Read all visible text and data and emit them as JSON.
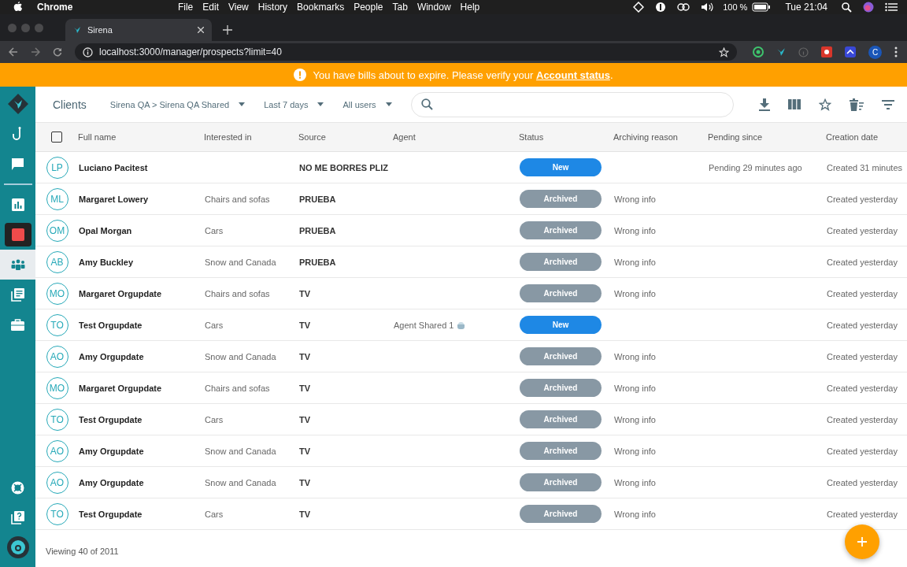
{
  "menu_bar": {
    "app": "Chrome",
    "items": [
      "File",
      "Edit",
      "View",
      "History",
      "Bookmarks",
      "People",
      "Tab",
      "Window",
      "Help"
    ],
    "battery": "100 %",
    "clock": "Tue 21:04"
  },
  "browser": {
    "tab_title": "Sirena",
    "url": "localhost:3000/manager/prospects?limit=40",
    "profile": "C"
  },
  "banner": {
    "text": "You have bills about to expire. Please verify your",
    "link": "Account status",
    "tail": "."
  },
  "sidebar": {
    "items": [
      {
        "kind": "hook",
        "selected": false
      },
      {
        "kind": "chat",
        "selected": false
      },
      {
        "kind": "divider",
        "selected": false
      },
      {
        "kind": "chart",
        "selected": false
      },
      {
        "kind": "record",
        "selected": false
      },
      {
        "kind": "people",
        "selected": true
      },
      {
        "kind": "docs",
        "selected": false
      },
      {
        "kind": "briefcase",
        "selected": false
      }
    ],
    "bottom": [
      {
        "kind": "lifebuoy"
      },
      {
        "kind": "help"
      },
      {
        "kind": "avatar"
      }
    ]
  },
  "header": {
    "title": "Clients",
    "filters": [
      "Sirena QA > Sirena QA Shared",
      "Last 7 days",
      "All users"
    ]
  },
  "table": {
    "select_all": false,
    "columns": [
      "Full name",
      "Interested in",
      "Source",
      "Agent",
      "Status",
      "Archiving reason",
      "Pending since",
      "Creation date"
    ],
    "rows": [
      {
        "initials": "LP",
        "name": "Luciano Pacitest",
        "interest": "",
        "source": "NO ME BORRES PLIZ",
        "agent": "",
        "status": "New",
        "archived": false,
        "reason": "",
        "pending": "Pending 29 minutes ago",
        "created": "Created 31 minutes"
      },
      {
        "initials": "ML",
        "name": "Margaret Lowery",
        "interest": "Chairs and sofas",
        "source": "PRUEBA",
        "agent": "",
        "status": "Archived",
        "archived": true,
        "reason": "Wrong info",
        "pending": "",
        "created": "Created yesterday"
      },
      {
        "initials": "OM",
        "name": "Opal Morgan",
        "interest": "Cars",
        "source": "PRUEBA",
        "agent": "",
        "status": "Archived",
        "archived": true,
        "reason": "Wrong info",
        "pending": "",
        "created": "Created yesterday"
      },
      {
        "initials": "AB",
        "name": "Amy Buckley",
        "interest": "Snow and Canada",
        "source": "PRUEBA",
        "agent": "",
        "status": "Archived",
        "archived": true,
        "reason": "Wrong info",
        "pending": "",
        "created": "Created yesterday"
      },
      {
        "initials": "MO",
        "name": "Margaret Orgupdate",
        "interest": "Chairs and sofas",
        "source": "TV",
        "agent": "",
        "status": "Archived",
        "archived": true,
        "reason": "Wrong info",
        "pending": "",
        "created": "Created yesterday"
      },
      {
        "initials": "TO",
        "name": "Test Orgupdate",
        "interest": "Cars",
        "source": "TV",
        "agent": "Agent Shared 1",
        "status": "New",
        "archived": false,
        "reason": "",
        "pending": "",
        "created": "Created yesterday"
      },
      {
        "initials": "AO",
        "name": "Amy Orgupdate",
        "interest": "Snow and Canada",
        "source": "TV",
        "agent": "",
        "status": "Archived",
        "archived": true,
        "reason": "Wrong info",
        "pending": "",
        "created": "Created yesterday"
      },
      {
        "initials": "MO",
        "name": "Margaret Orgupdate",
        "interest": "Chairs and sofas",
        "source": "TV",
        "agent": "",
        "status": "Archived",
        "archived": true,
        "reason": "Wrong info",
        "pending": "",
        "created": "Created yesterday"
      },
      {
        "initials": "TO",
        "name": "Test Orgupdate",
        "interest": "Cars",
        "source": "TV",
        "agent": "",
        "status": "Archived",
        "archived": true,
        "reason": "Wrong info",
        "pending": "",
        "created": "Created yesterday"
      },
      {
        "initials": "AO",
        "name": "Amy Orgupdate",
        "interest": "Snow and Canada",
        "source": "TV",
        "agent": "",
        "status": "Archived",
        "archived": true,
        "reason": "Wrong info",
        "pending": "",
        "created": "Created yesterday"
      },
      {
        "initials": "AO",
        "name": "Amy Orgupdate",
        "interest": "Snow and Canada",
        "source": "TV",
        "agent": "",
        "status": "Archived",
        "archived": true,
        "reason": "Wrong info",
        "pending": "",
        "created": "Created yesterday"
      },
      {
        "initials": "TO",
        "name": "Test Orgupdate",
        "interest": "Cars",
        "source": "TV",
        "agent": "",
        "status": "Archived",
        "archived": true,
        "reason": "Wrong info",
        "pending": "",
        "created": "Created yesterday"
      }
    ]
  },
  "footer": "Viewing 40 of 2011"
}
